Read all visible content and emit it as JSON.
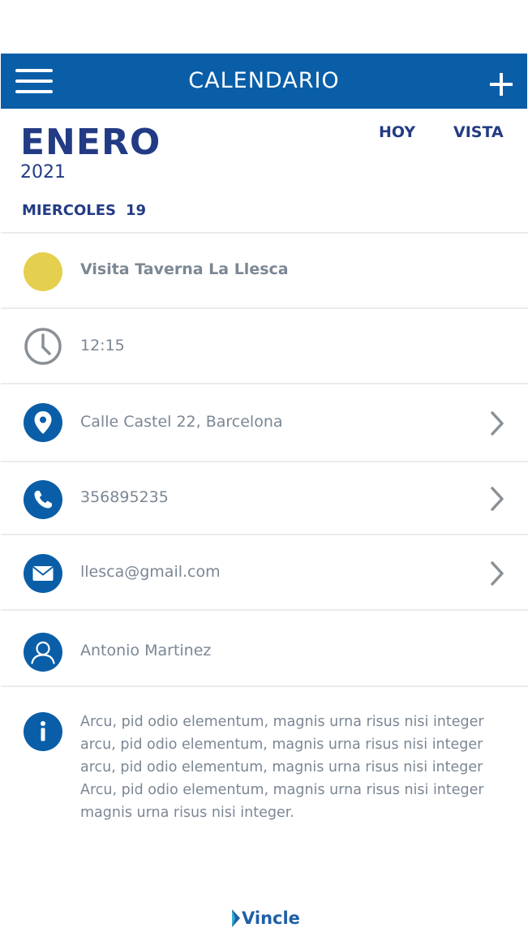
{
  "header": {
    "title": "CALENDARIO"
  },
  "calendar": {
    "month": "ENERO",
    "year": "2021",
    "today_label": "HOY",
    "view_label": "VISTA",
    "weekday": "MIERCOLES",
    "day_number": "19"
  },
  "event": {
    "title": "Visita Taverna La Llesca",
    "title_color": "#e5cf4f",
    "time": "12:15",
    "address": "Calle Castel 22, Barcelona",
    "phone": "356895235",
    "email": "llesca@gmail.com",
    "contact": "Antonio Martinez",
    "description": "Arcu, pid odio elementum, magnis urna risus nisi integer arcu, pid odio elementum, magnis urna risus nisi integer arcu, pid odio elementum, magnis urna risus nisi integer Arcu, pid odio elementum, magnis urna risus nisi integer magnis urna risus nisi integer."
  },
  "colors": {
    "brand_blue": "#0a5ea8",
    "heading_navy": "#233b85",
    "text_gray": "#7b8794"
  },
  "icons": {
    "menu": "hamburger-menu-icon",
    "add": "plus-icon",
    "time": "clock-icon",
    "address": "location-pin-icon",
    "phone": "phone-icon",
    "email": "envelope-icon",
    "contact": "user-icon",
    "info": "info-icon",
    "chevron": "chevron-right-icon"
  },
  "footer": {
    "logo_text": "Vincle"
  }
}
